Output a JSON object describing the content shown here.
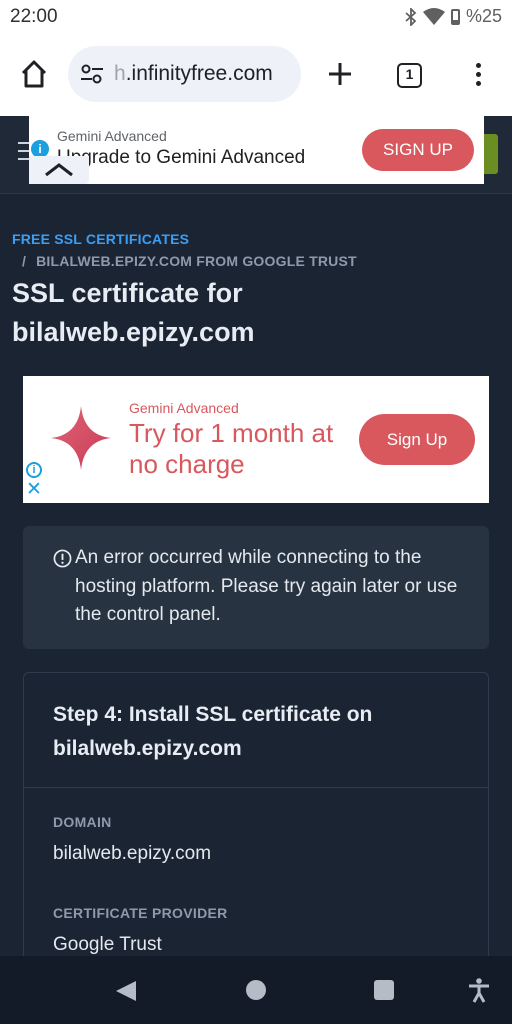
{
  "status": {
    "time": "22:00",
    "battery": "%25"
  },
  "browser": {
    "url_faded": "h",
    "url": ".infinityfree.com",
    "tab_count": "1"
  },
  "ad_top": {
    "brand": "Gemini Advanced",
    "headline": "Upgrade to Gemini Advanced",
    "cta": "SIGN UP"
  },
  "breadcrumbs": {
    "parent": "FREE SSL CERTIFICATES",
    "separator": "/",
    "current": "BILALWEB.EPIZY.COM FROM GOOGLE TRUST"
  },
  "page": {
    "title": "SSL certificate for bilalweb.epizy.com"
  },
  "ad_inline": {
    "brand": "Gemini Advanced",
    "headline": "Try for 1 month at no charge",
    "cta": "Sign Up",
    "close": "✕"
  },
  "alert": {
    "message": "An error occurred while connecting to the hosting platform. Please try again later or use the control panel."
  },
  "step": {
    "heading": "Step 4: Install SSL certificate on bilalweb.epizy.com",
    "domain_label": "DOMAIN",
    "domain_value": "bilalweb.epizy.com",
    "provider_label": "CERTIFICATE PROVIDER",
    "provider_value": "Google Trust"
  },
  "colors": {
    "page_bg": "#1b2433",
    "accent_link": "#3b9ef5",
    "ad_red": "#d8585e"
  }
}
